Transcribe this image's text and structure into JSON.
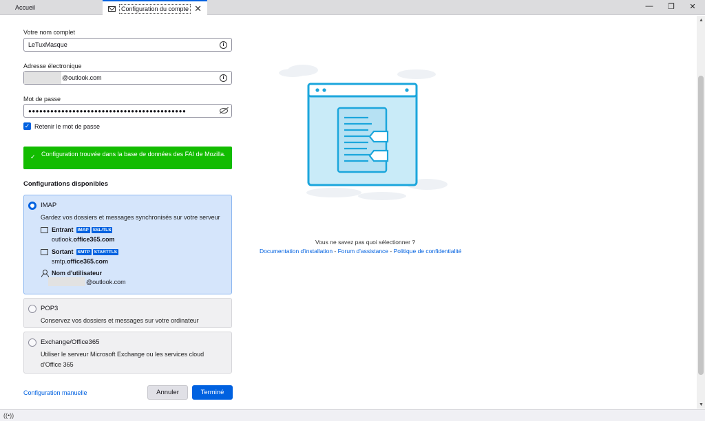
{
  "tabs": {
    "home_label": "Accueil",
    "active_label": "Configuration du compte",
    "close_glyph": "✕"
  },
  "window": {
    "minimize": "—",
    "restore": "❐",
    "close": "✕"
  },
  "form": {
    "name_label": "Votre nom complet",
    "name_value": "LeTuxMasque",
    "email_label": "Adresse électronique",
    "email_suffix": "@outlook.com",
    "password_label": "Mot de passe",
    "password_value": "●●●●●●●●●●●●●●●●●●●●●●●●●●●●●●●●●●●●●●●●●●●",
    "remember_label": "Retenir le mot de passe",
    "remember_checked": true
  },
  "success_message": "Configuration trouvée dans la base de données des FAI de Mozilla.",
  "configs": {
    "title": "Configurations disponibles",
    "imap": {
      "name": "IMAP",
      "description": "Gardez vos dossiers et messages synchronisés sur votre serveur",
      "incoming_label": "Entrant",
      "incoming_tags": [
        "IMAP",
        "SSL/TLS"
      ],
      "incoming_host_prefix": "outlook.",
      "incoming_host_domain": "office365.com",
      "outgoing_label": "Sortant",
      "outgoing_tags": [
        "SMTP",
        "STARTTLS"
      ],
      "outgoing_host_prefix": "smtp.",
      "outgoing_host_domain": "office365.com",
      "username_label": "Nom d'utilisateur",
      "username_suffix": "@outlook.com"
    },
    "pop3": {
      "name": "POP3",
      "description": "Conservez vos dossiers et messages sur votre ordinateur"
    },
    "exchange": {
      "name": "Exchange/Office365",
      "description": "Utiliser le serveur Microsoft Exchange ou les services cloud d'Office 365"
    }
  },
  "actions": {
    "manual": "Configuration manuelle",
    "cancel": "Annuler",
    "done": "Terminé"
  },
  "help": {
    "question": "Vous ne savez pas quoi sélectionner ?",
    "doc": "Documentation d'installation",
    "sep": " - ",
    "forum": "Forum d'assistance",
    "privacy": "Politique de confidentialité"
  },
  "colors": {
    "accent": "#0061e0",
    "success": "#12bc00",
    "illustration": "#1ba6dc"
  }
}
